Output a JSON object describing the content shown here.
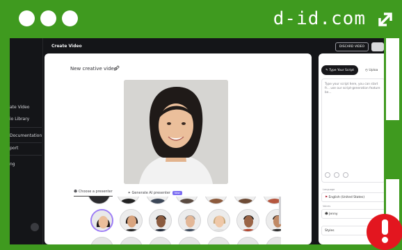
{
  "browser": {
    "domain": "d-id.com",
    "expand_icon": "expand-arrow-icon"
  },
  "sidebar": {
    "items": [
      {
        "label": "ate Video"
      },
      {
        "label": "io Library"
      },
      {
        "label": "Documentation"
      },
      {
        "label": "port"
      },
      {
        "label": "ng"
      }
    ]
  },
  "header": {
    "title": "Create Video",
    "discard_label": "DISCARD VIDEO"
  },
  "editor": {
    "video_title": "New creative video",
    "tabs": [
      {
        "label": "Choose a presenter"
      },
      {
        "label": "Generate AI presenter"
      }
    ],
    "beta_label": "New"
  },
  "script_panel": {
    "tabs": [
      {
        "label": "Type Your Script"
      },
      {
        "label": "Uploa"
      }
    ],
    "placeholder": "Type your script here, you can start fr... use our script-generation feature be...",
    "language_label": "Language",
    "language_value": "English (United States)",
    "voice_label": "Voices",
    "voice_value": "Jenny",
    "styles_value": "Styles"
  },
  "colors": {
    "frame_green": "#3f9a1f",
    "app_dark": "#141518",
    "selection_purple": "#9c7cf6",
    "alert_red": "#e3161f"
  }
}
